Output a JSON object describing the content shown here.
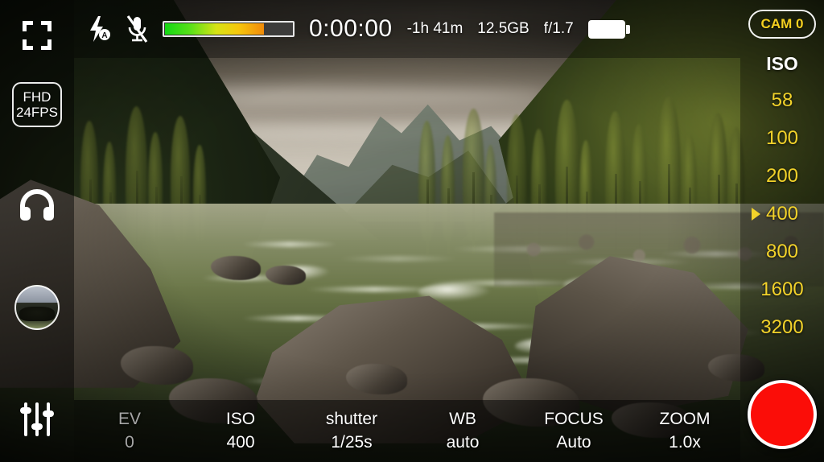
{
  "app": {
    "name": "camera-viewfinder"
  },
  "top_bar": {
    "flash_icon": "flash-auto-icon",
    "mic_icon": "microphone-muted-icon",
    "audio_meter": {
      "name": "audio-level-meter",
      "level_percent": 78
    },
    "timer": "0:00:00",
    "remaining": "-1h 41m",
    "storage": "12.5GB",
    "aperture": "f/1.7",
    "battery_icon": "battery-full-icon"
  },
  "left_sidebar": {
    "crop_icon": "fullscreen-crop-icon",
    "mode_badge": {
      "resolution": "FHD",
      "framerate": "24FPS"
    },
    "headphone_icon": "headphones-icon",
    "gallery_thumb": "gallery-thumbnail",
    "settings_icon": "sliders-settings-icon"
  },
  "right_sidebar": {
    "cam_badge": "CAM 0",
    "iso_title": "ISO",
    "iso_values": [
      "58",
      "100",
      "200",
      "400",
      "800",
      "1600",
      "3200"
    ],
    "iso_selected": "400",
    "record_button": "record-button"
  },
  "bottom_bar": {
    "controls": [
      {
        "key": "EV",
        "value": "0",
        "dim": true
      },
      {
        "key": "ISO",
        "value": "400",
        "dim": false
      },
      {
        "key": "shutter",
        "value": "1/25s",
        "dim": false
      },
      {
        "key": "WB",
        "value": "auto",
        "dim": false
      },
      {
        "key": "FOCUS",
        "value": "Auto",
        "dim": false
      },
      {
        "key": "ZOOM",
        "value": "1.0x",
        "dim": false
      }
    ]
  },
  "colors": {
    "accent_yellow": "#f2d22a",
    "record_red": "#fb0d08",
    "meter_green": "#14d814",
    "meter_orange": "#f08a0a"
  }
}
